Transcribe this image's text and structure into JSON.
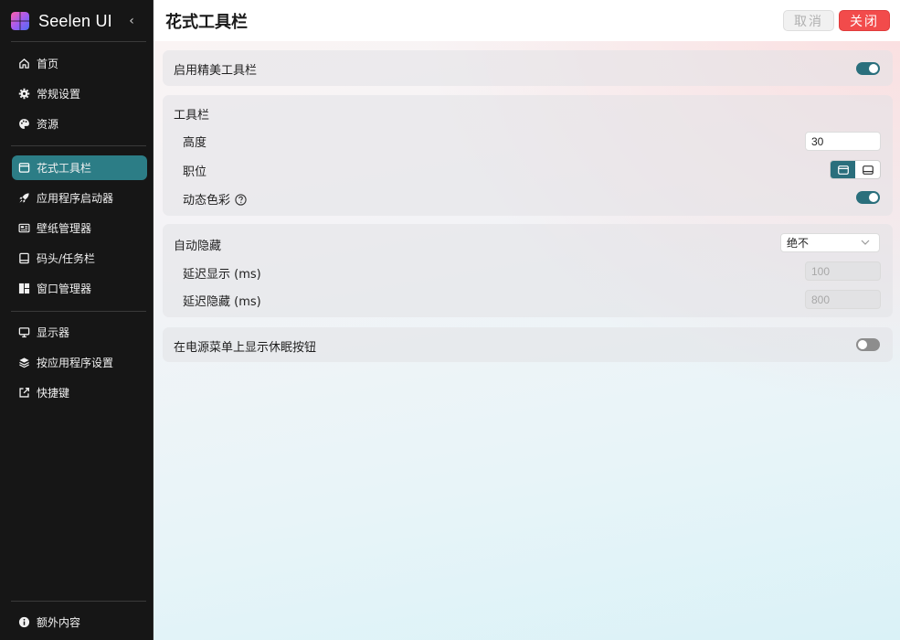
{
  "app": {
    "name": "Seelen UI",
    "collapse_glyph": "‹"
  },
  "sidebar": {
    "group1": [
      {
        "label": "首页",
        "icon": "home-icon"
      },
      {
        "label": "常规设置",
        "icon": "gear-icon"
      },
      {
        "label": "资源",
        "icon": "palette-icon"
      }
    ],
    "group2": [
      {
        "label": "花式工具栏",
        "icon": "toolbar-icon",
        "active": true
      },
      {
        "label": "应用程序启动器",
        "icon": "rocket-icon"
      },
      {
        "label": "壁纸管理器",
        "icon": "wallpaper-icon"
      },
      {
        "label": "码头/任务栏",
        "icon": "dock-icon"
      },
      {
        "label": "窗口管理器",
        "icon": "layout-icon"
      }
    ],
    "group3": [
      {
        "label": "显示器",
        "icon": "monitor-icon"
      },
      {
        "label": "按应用程序设置",
        "icon": "layers-icon"
      },
      {
        "label": "快捷键",
        "icon": "external-link-icon"
      }
    ],
    "footer": {
      "label": "额外内容",
      "icon": "info-icon"
    }
  },
  "header": {
    "title": "花式工具栏",
    "cancel_label": "取消",
    "close_label": "关闭"
  },
  "settings": {
    "enable": {
      "label": "启用精美工具栏",
      "value": true
    },
    "toolbar": {
      "title": "工具栏",
      "height_label": "高度",
      "height_value": "30",
      "position_label": "职位",
      "position_selected": "top",
      "dynamic_color_label": "动态色彩",
      "dynamic_color_value": true
    },
    "autohide": {
      "title": "自动隐藏",
      "mode_value": "绝不",
      "delay_show_label": "延迟显示 (ms)",
      "delay_show_value": "100",
      "delay_hide_label": "延迟隐藏 (ms)",
      "delay_hide_value": "800"
    },
    "hibernate": {
      "label": "在电源菜单上显示休眠按钮",
      "value": false
    }
  },
  "colors": {
    "sidebar_bg": "#161616",
    "active_item": "#2c7d86",
    "toggle_on": "#2a6f7c",
    "close_button": "#f24b4b"
  }
}
